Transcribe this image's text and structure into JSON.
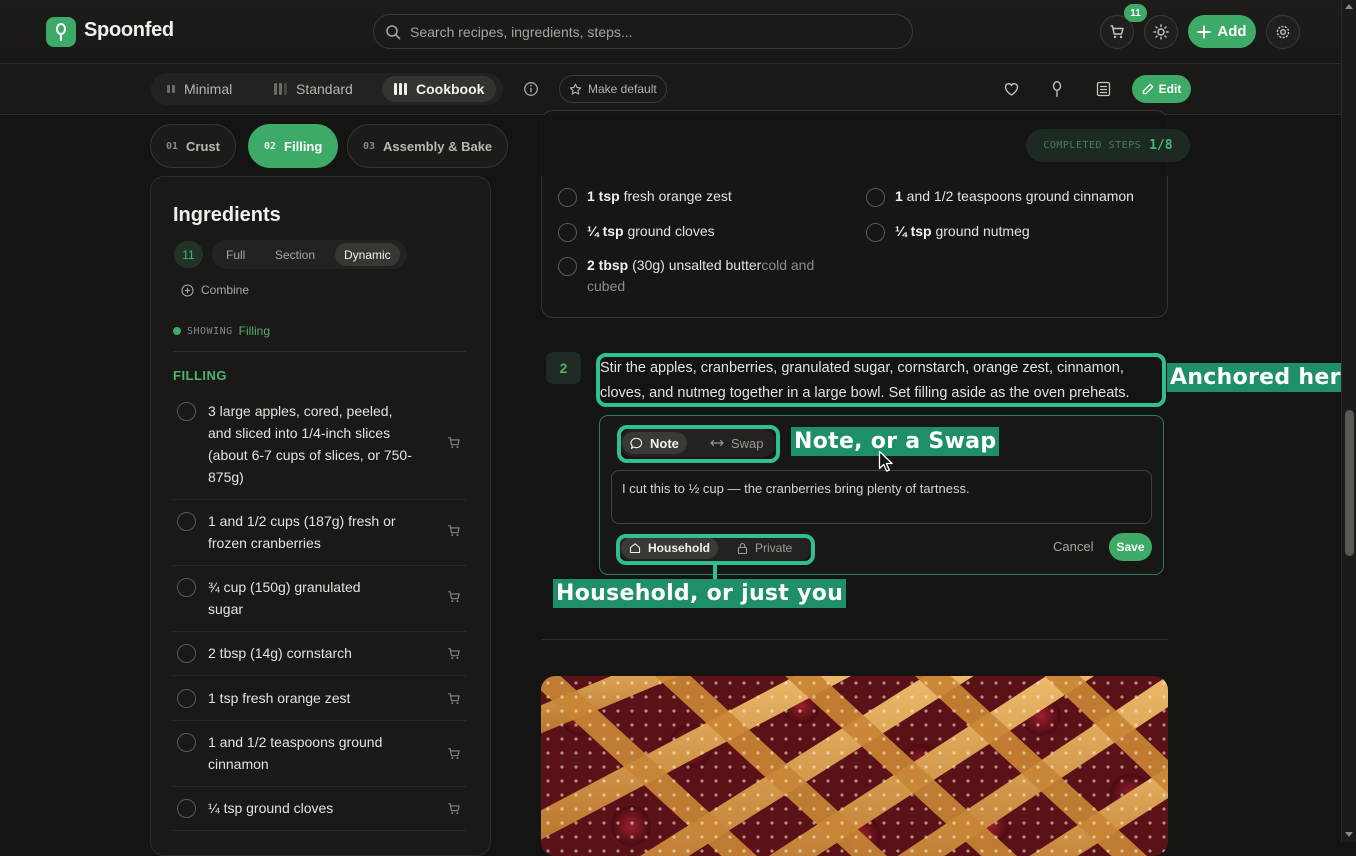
{
  "header": {
    "brand": "Spoonfed",
    "search_placeholder": "Search recipes, ingredients, steps...",
    "cart_count": "11",
    "add_label": "Add"
  },
  "viewbar": {
    "modes": [
      "Minimal",
      "Standard",
      "Cookbook"
    ],
    "active_mode": "Cookbook",
    "make_default": "Make default",
    "edit_label": "Edit"
  },
  "sections": {
    "tabs": [
      {
        "num": "01",
        "label": "Crust"
      },
      {
        "num": "02",
        "label": "Filling"
      },
      {
        "num": "03",
        "label": "Assembly & Bake"
      }
    ],
    "active": "Filling",
    "completed_label": "COMPLETED STEPS",
    "completed_value": "1/8"
  },
  "ingredients_panel": {
    "title": "Ingredients",
    "count": "11",
    "view_modes": [
      "Full",
      "Section",
      "Dynamic"
    ],
    "active_view": "Dynamic",
    "combine_label": "Combine",
    "showing_label": "SHOWING",
    "showing_section": "Filling",
    "section_heading": "FILLING",
    "items": [
      "3 large apples, cored, peeled, and sliced into 1/4-inch slices (about 6-7 cups of slices, or 750-875g)",
      "1 and 1/2 cups (187g) fresh or frozen cranberries",
      "¾ cup (150g) granulated sugar",
      "2 tbsp (14g) cornstarch",
      "1 tsp fresh orange zest",
      "1 and 1/2 teaspoons ground cinnamon",
      "¼ tsp ground cloves"
    ]
  },
  "step_ingredients": {
    "items": [
      {
        "qty": "1 tsp",
        "name": " fresh orange zest",
        "note": ""
      },
      {
        "qty": "1",
        "name": " and 1/2 teaspoons ground cinnamon",
        "note": ""
      },
      {
        "qty": "¼ tsp",
        "name": " ground cloves",
        "note": ""
      },
      {
        "qty": "¼ tsp",
        "name": " ground nutmeg",
        "note": ""
      },
      {
        "qty": "2 tbsp",
        "name": " (30g) unsalted butter",
        "note": "cold and cubed"
      }
    ]
  },
  "step": {
    "number": "2",
    "text": "Stir the apples, cranberries, granulated sugar, cornstarch, orange zest, cinnamon, cloves, and nutmeg together in a large bowl. Set filling aside as the oven preheats."
  },
  "note_editor": {
    "types": [
      "Note",
      "Swap"
    ],
    "active_type": "Note",
    "text": "I cut this to ½ cup — the cranberries bring plenty of tartness.",
    "visibility": [
      "Household",
      "Private"
    ],
    "active_visibility": "Household",
    "cancel_label": "Cancel",
    "save_label": "Save"
  },
  "annotations": {
    "anchored": "Anchored here",
    "note_swap": "Note, or a Swap",
    "household": "Household, or just you"
  },
  "colors": {
    "accent": "#3daa68",
    "callout": "#2fbf91",
    "background": "#141413"
  }
}
